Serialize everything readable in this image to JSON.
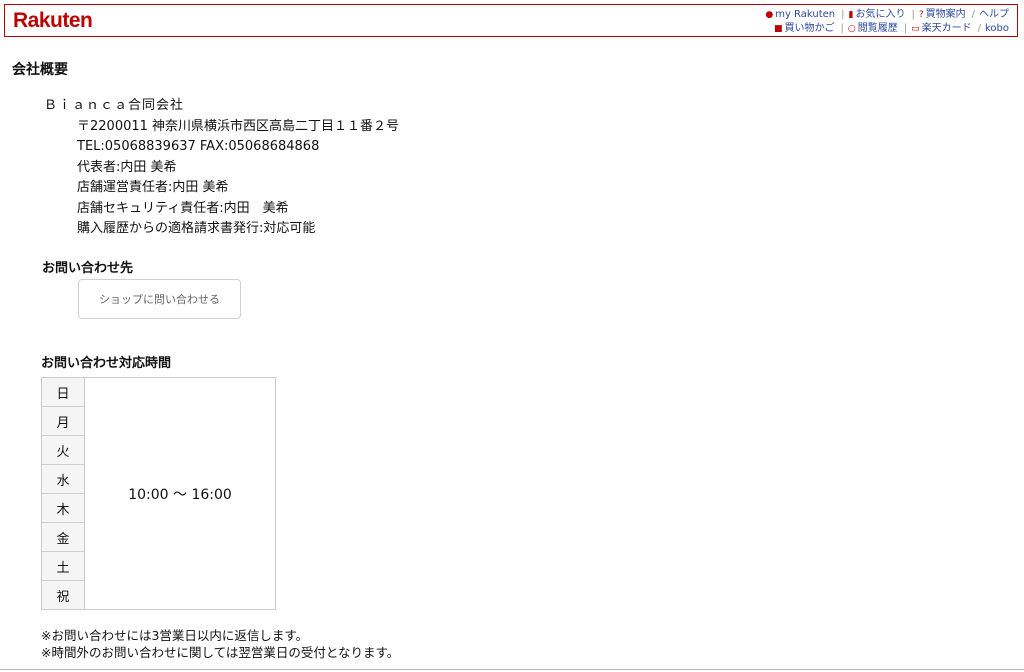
{
  "header": {
    "logo": "Rakuten",
    "nav_row1": [
      {
        "icon": "person-icon",
        "label": "my Rakuten"
      },
      {
        "icon": "bookmark-icon",
        "label": "お気に入り"
      },
      {
        "icon": "question-icon",
        "label": "買物案内"
      },
      {
        "icon": "",
        "label": "ヘルプ"
      }
    ],
    "nav_row2": [
      {
        "icon": "cart-icon",
        "label": "買い物かご"
      },
      {
        "icon": "search-icon",
        "label": "閲覧履歴"
      },
      {
        "icon": "card-icon",
        "label": "楽天カード"
      },
      {
        "icon": "",
        "label": "kobo"
      }
    ]
  },
  "page_title": "会社概要",
  "company": {
    "name": "Ｂｉａｎｃａ合同会社",
    "lines": [
      "〒2200011 神奈川県横浜市西区高島二丁目１１番２号",
      "TEL:05068839637 FAX:05068684868",
      "代表者:内田 美希",
      "店舗運営責任者:内田 美希",
      "店舗セキュリティ責任者:内田　美希",
      "購入履歴からの適格請求書発行:対応可能"
    ]
  },
  "contact": {
    "title": "お問い合わせ先",
    "button_label": "ショップに問い合わせる"
  },
  "hours": {
    "title": "お問い合わせ対応時間",
    "days": [
      "日",
      "月",
      "火",
      "水",
      "木",
      "金",
      "土",
      "祝"
    ],
    "time": "10:00 ～ 16:00"
  },
  "notes": [
    "※お問い合わせには3営業日以内に返信します。",
    "※時間外のお問い合わせに関しては翌営業日の受付となります。"
  ],
  "colors": {
    "brand": "#bf0000",
    "link": "#2b4a9a"
  }
}
